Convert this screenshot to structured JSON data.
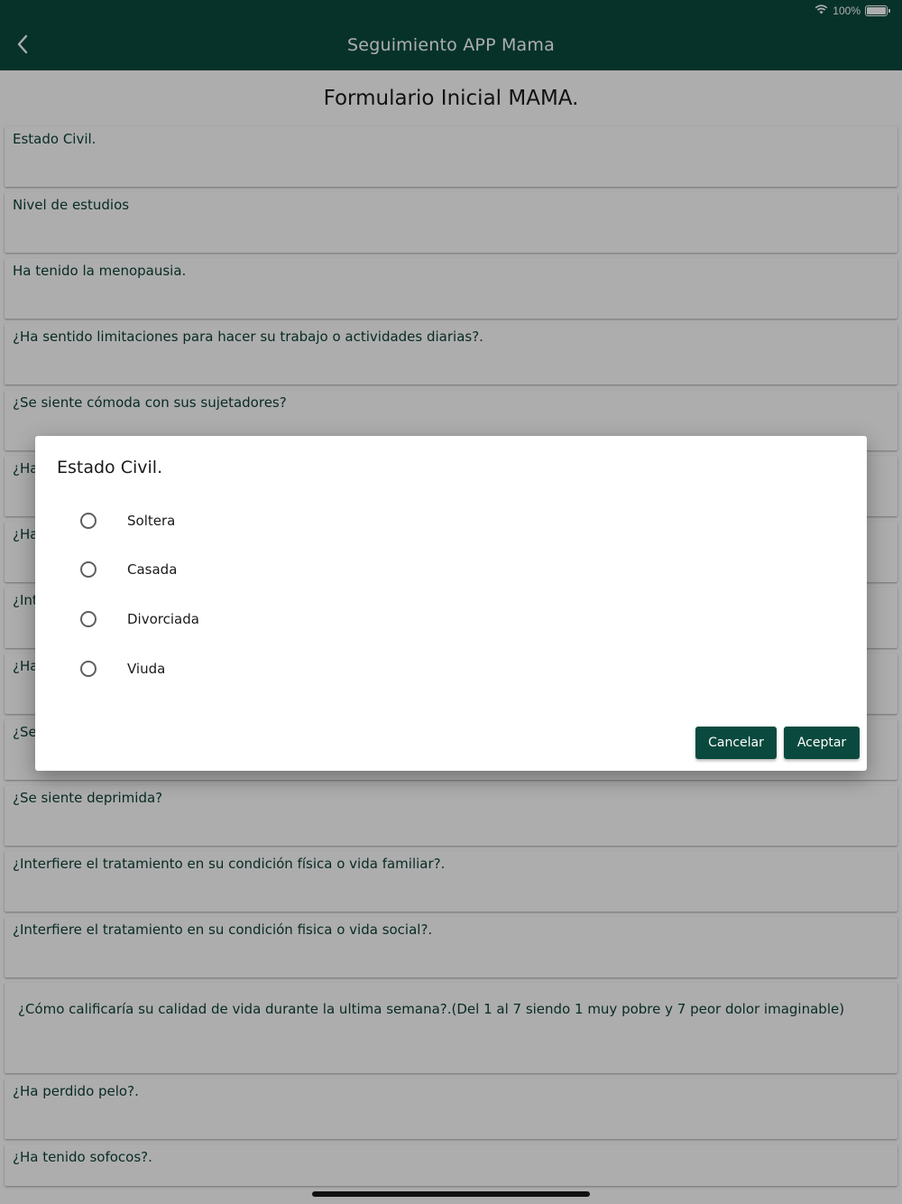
{
  "status_bar": {
    "battery": "100%"
  },
  "app_bar": {
    "title": "Seguimiento APP Mama"
  },
  "form": {
    "title": "Formulario Inicial MAMA.",
    "fields": [
      "Estado Civil.",
      "Nivel de estudios",
      "Ha tenido la menopausia.",
      "¿Ha sentido limitaciones para hacer su trabajo o actividades diarias?.",
      "¿Se siente cómoda con sus sujetadores?",
      "¿Ha",
      "¿Ha",
      "¿Int",
      "¿Ha",
      "¿Se",
      "¿Se siente deprimida?",
      "¿Interfiere el tratamiento en su condición física o vida familiar?.",
      "¿Interfiere el tratamiento en su condición fisica o vida social?.",
      "¿Cómo calificaría su calidad de vida durante la ultima semana?.(Del 1 al 7 siendo 1 muy pobre y 7 peor dolor imaginable)",
      "¿Ha perdido pelo?.",
      "¿Ha tenido sofocos?."
    ]
  },
  "dialog": {
    "title": "Estado Civil.",
    "options": [
      "Soltera",
      "Casada",
      "Divorciada",
      "Viuda"
    ],
    "cancel_label": "Cancelar",
    "accept_label": "Aceptar"
  },
  "colors": {
    "primary": "#0a4a3e",
    "text": "#0c3f35"
  }
}
